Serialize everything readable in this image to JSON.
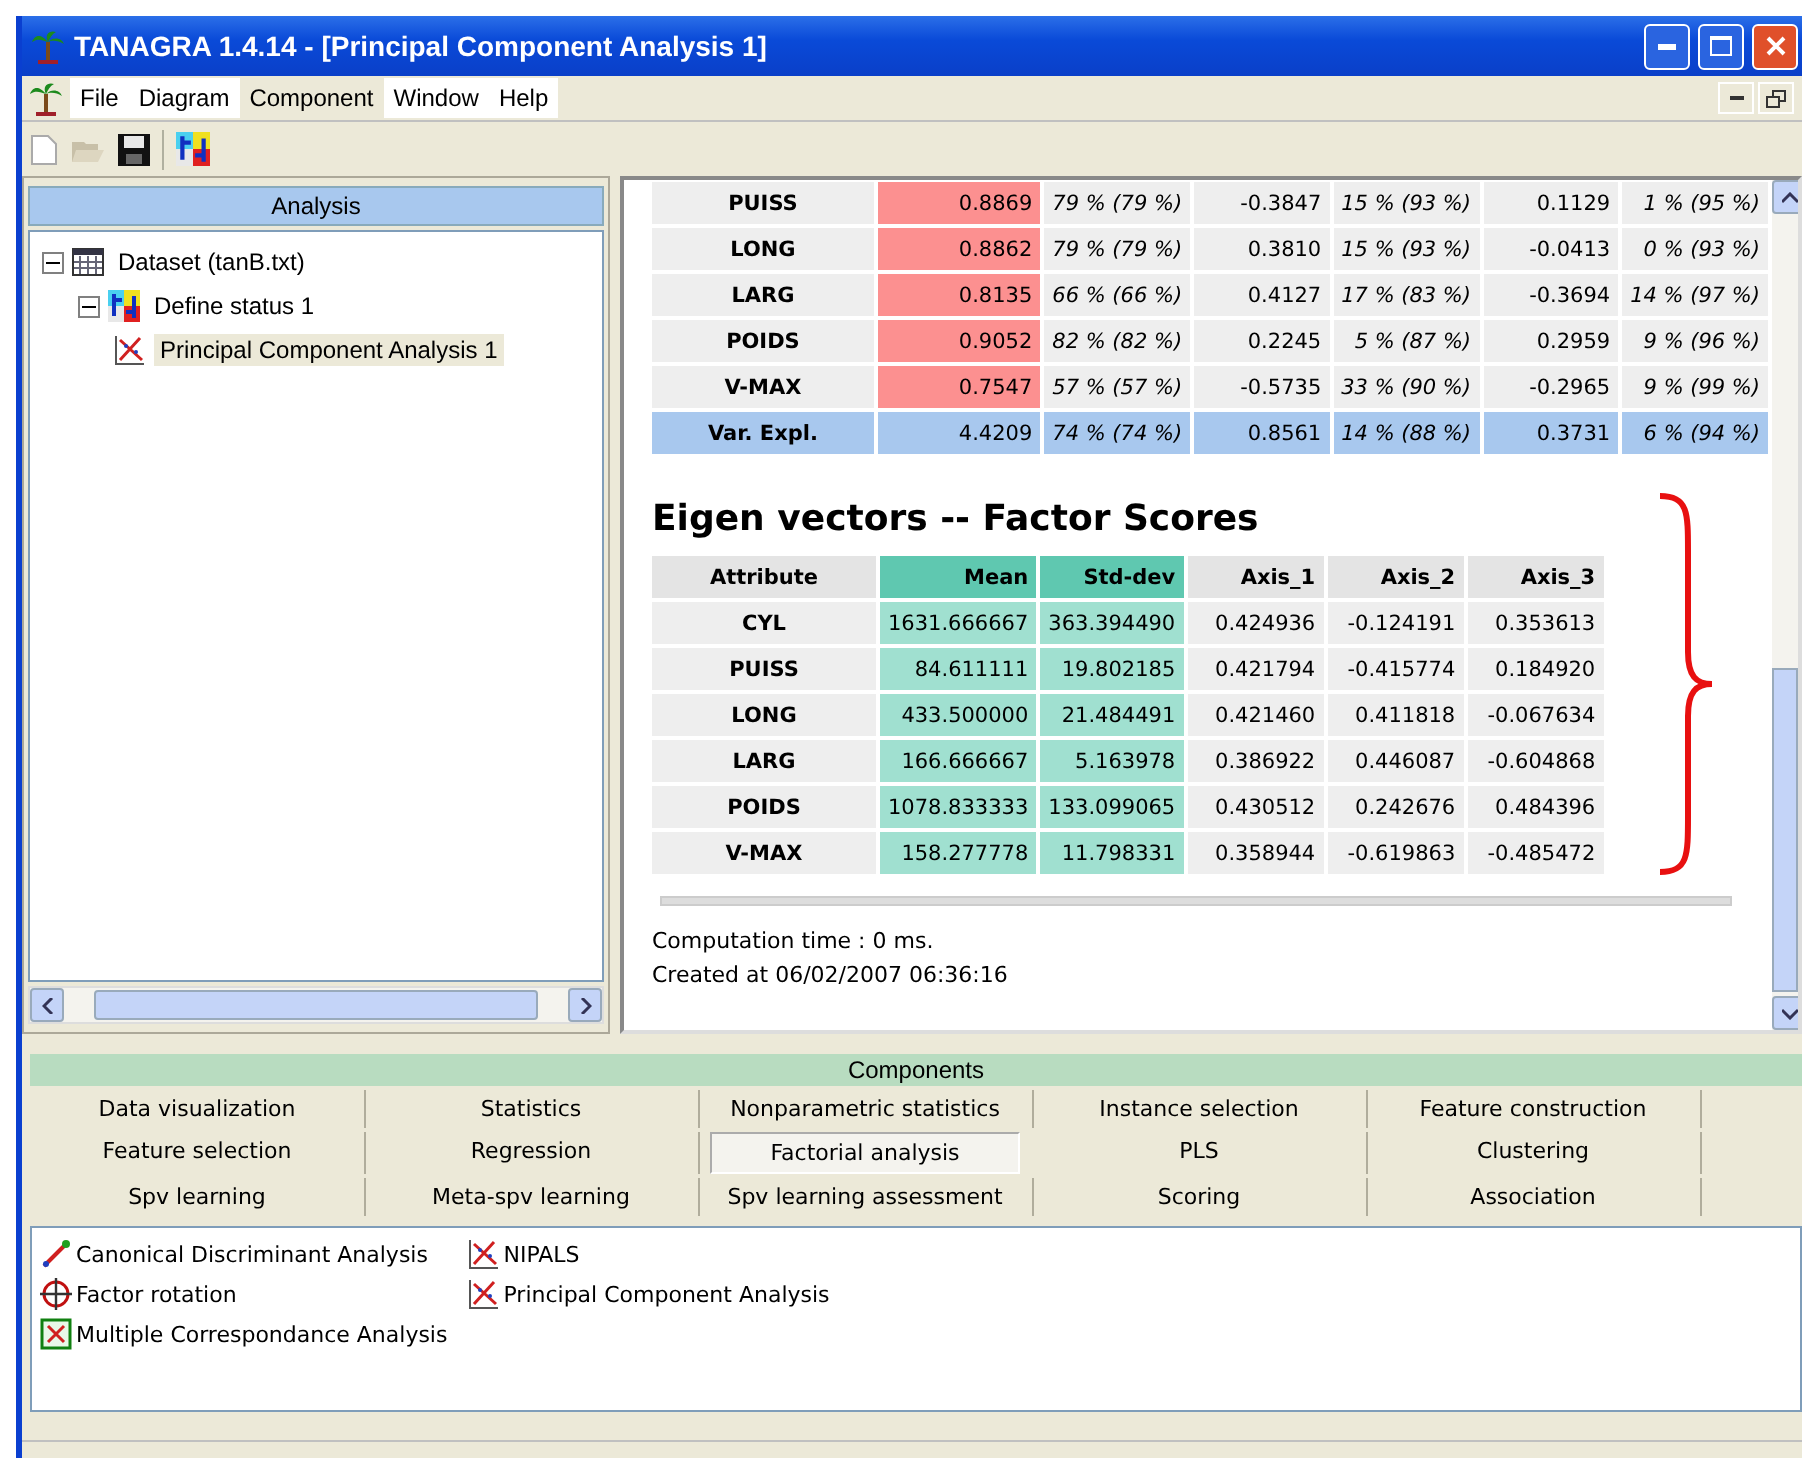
{
  "window": {
    "title": "TANAGRA 1.4.14 - [Principal Component Analysis 1]"
  },
  "menu": [
    {
      "label": "File",
      "selected": false
    },
    {
      "label": "Diagram",
      "selected": false
    },
    {
      "label": "Component",
      "selected": true
    },
    {
      "label": "Window",
      "selected": false
    },
    {
      "label": "Help",
      "selected": false
    }
  ],
  "analysis": {
    "title": "Analysis",
    "tree": [
      {
        "label": "Dataset (tanB.txt)",
        "kind": "dataset",
        "selected": false,
        "expanded": true,
        "children": [
          {
            "label": "Define status 1",
            "kind": "status",
            "selected": false,
            "expanded": true,
            "children": [
              {
                "label": "Principal Component Analysis 1",
                "kind": "pca",
                "selected": true
              }
            ]
          }
        ]
      }
    ]
  },
  "report": {
    "loadings": {
      "rows": [
        {
          "kind": "variable",
          "cells": [
            "PUISS",
            "0.8869",
            "79 % (79 %)",
            "-0.3847",
            "15 % (93 %)",
            "0.1129",
            "1 % (95 %)"
          ]
        },
        {
          "kind": "variable",
          "cells": [
            "LONG",
            "0.8862",
            "79 % (79 %)",
            "0.3810",
            "15 % (93 %)",
            "-0.0413",
            "0 % (93 %)"
          ]
        },
        {
          "kind": "variable",
          "cells": [
            "LARG",
            "0.8135",
            "66 % (66 %)",
            "0.4127",
            "17 % (83 %)",
            "-0.3694",
            "14 % (97 %)"
          ]
        },
        {
          "kind": "variable",
          "cells": [
            "POIDS",
            "0.9052",
            "82 % (82 %)",
            "0.2245",
            "5 % (87 %)",
            "0.2959",
            "9 % (96 %)"
          ]
        },
        {
          "kind": "variable",
          "cells": [
            "V-MAX",
            "0.7547",
            "57 % (57 %)",
            "-0.5735",
            "33 % (90 %)",
            "-0.2965",
            "9 % (99 %)"
          ]
        },
        {
          "kind": "total",
          "cells": [
            "Var. Expl.",
            "4.4209",
            "74 % (74 %)",
            "0.8561",
            "14 % (88 %)",
            "0.3731",
            "6 % (94 %)"
          ]
        }
      ]
    },
    "eigen": {
      "title": "Eigen vectors -- Factor Scores",
      "columns": [
        {
          "label": "Attribute",
          "kind": "attribute"
        },
        {
          "label": "Mean",
          "kind": "stat"
        },
        {
          "label": "Std-dev",
          "kind": "stat"
        },
        {
          "label": "Axis_1",
          "kind": "axis"
        },
        {
          "label": "Axis_2",
          "kind": "axis"
        },
        {
          "label": "Axis_3",
          "kind": "axis"
        }
      ],
      "rows": [
        [
          "CYL",
          "1631.666667",
          "363.394490",
          "0.424936",
          "-0.124191",
          "0.353613"
        ],
        [
          "PUISS",
          "84.611111",
          "19.802185",
          "0.421794",
          "-0.415774",
          "0.184920"
        ],
        [
          "LONG",
          "433.500000",
          "21.484491",
          "0.421460",
          "0.411818",
          "-0.067634"
        ],
        [
          "LARG",
          "166.666667",
          "5.163978",
          "0.386922",
          "0.446087",
          "-0.604868"
        ],
        [
          "POIDS",
          "1078.833333",
          "133.099065",
          "0.430512",
          "0.242676",
          "0.484396"
        ],
        [
          "V-MAX",
          "158.277778",
          "11.798331",
          "0.358944",
          "-0.619863",
          "-0.485472"
        ]
      ]
    },
    "footer": [
      "Computation time : 0 ms.",
      "Created at 06/02/2007 06:36:16"
    ]
  },
  "components": {
    "title": "Components",
    "categories": [
      {
        "label": "Data visualization",
        "selected": false
      },
      {
        "label": "Statistics",
        "selected": false
      },
      {
        "label": "Nonparametric statistics",
        "selected": false
      },
      {
        "label": "Instance selection",
        "selected": false
      },
      {
        "label": "Feature construction",
        "selected": false
      },
      {
        "label": "Feature selection",
        "selected": false
      },
      {
        "label": "Regression",
        "selected": false
      },
      {
        "label": "Factorial analysis",
        "selected": true
      },
      {
        "label": "PLS",
        "selected": false
      },
      {
        "label": "Clustering",
        "selected": false
      },
      {
        "label": "Spv learning",
        "selected": false
      },
      {
        "label": "Meta-spv learning",
        "selected": false
      },
      {
        "label": "Spv learning assessment",
        "selected": false
      },
      {
        "label": "Scoring",
        "selected": false
      },
      {
        "label": "Association",
        "selected": false
      }
    ],
    "items": [
      {
        "label": "Canonical Discriminant Analysis",
        "kind": "line"
      },
      {
        "label": "Factor rotation",
        "kind": "crosshair"
      },
      {
        "label": "Multiple Correspondance Analysis",
        "kind": "matrix"
      },
      {
        "label": "NIPALS",
        "kind": "scatter"
      },
      {
        "label": "Principal Component Analysis",
        "kind": "scatter"
      }
    ]
  }
}
